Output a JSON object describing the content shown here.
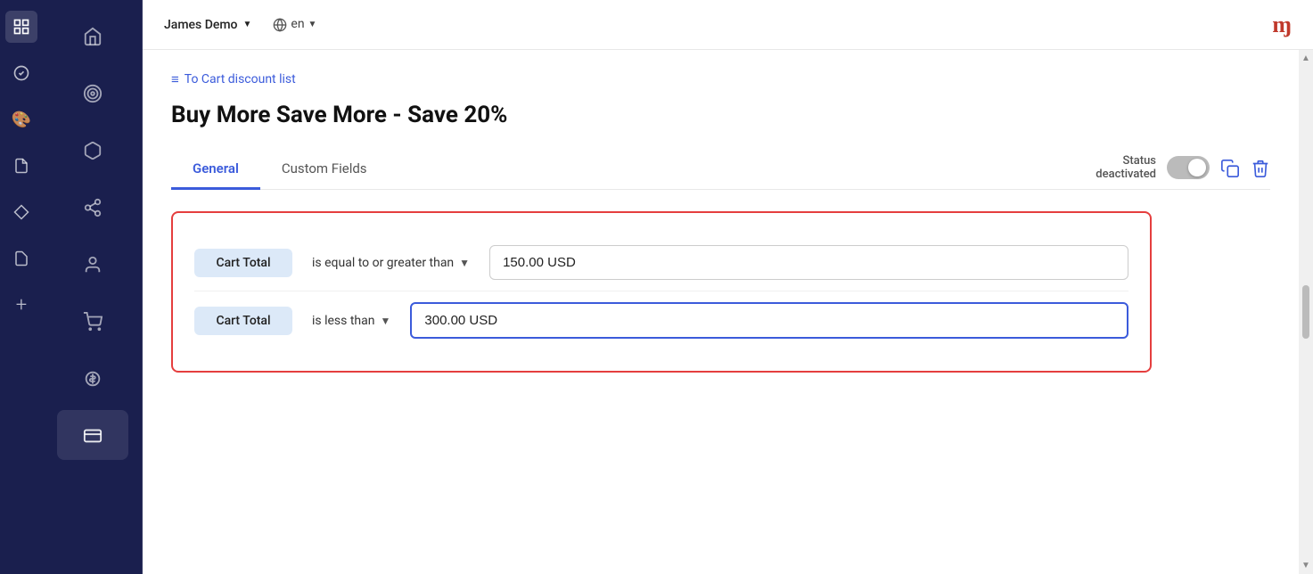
{
  "sidebar_narrow": {
    "icons": [
      {
        "name": "grid-icon",
        "symbol": "⊞",
        "active": false
      },
      {
        "name": "badge-icon",
        "symbol": "◈",
        "active": true
      },
      {
        "name": "palette-icon",
        "symbol": "🎨",
        "active": false
      },
      {
        "name": "document-icon",
        "symbol": "📄",
        "active": false
      },
      {
        "name": "diamond-icon",
        "symbol": "◇",
        "active": false
      },
      {
        "name": "doc2-icon",
        "symbol": "📋",
        "active": false
      },
      {
        "name": "plus-icon",
        "symbol": "+",
        "active": false
      }
    ]
  },
  "sidebar_main": {
    "items": [
      {
        "name": "home-nav",
        "label": "",
        "icon": "🏠",
        "active": false
      },
      {
        "name": "target-nav",
        "label": "",
        "icon": "🎯",
        "active": false
      },
      {
        "name": "cube-nav",
        "label": "",
        "icon": "⬡",
        "active": false
      },
      {
        "name": "flow-nav",
        "label": "",
        "icon": "⚡",
        "active": false
      },
      {
        "name": "person-nav",
        "label": "",
        "icon": "👤",
        "active": false
      },
      {
        "name": "cart-nav",
        "label": "",
        "icon": "🛒",
        "active": false
      },
      {
        "name": "coins-nav",
        "label": "",
        "icon": "🪙",
        "active": false
      },
      {
        "name": "card-nav",
        "label": "",
        "icon": "🃏",
        "active": true
      }
    ]
  },
  "topbar": {
    "user_name": "James Demo",
    "user_chevron": "▼",
    "lang": "en",
    "lang_chevron": "▼",
    "logo": "ɱ"
  },
  "breadcrumb": {
    "icon": "≡",
    "label": "To Cart discount list"
  },
  "page": {
    "title": "Buy More Save More - Save 20%"
  },
  "tabs": [
    {
      "id": "general",
      "label": "General",
      "active": true
    },
    {
      "id": "custom-fields",
      "label": "Custom Fields",
      "active": false
    }
  ],
  "status": {
    "label_line1": "Status",
    "label_line2": "deactivated",
    "toggle_state": "off"
  },
  "action_buttons": {
    "copy_label": "copy",
    "delete_label": "delete"
  },
  "conditions": [
    {
      "id": "row1",
      "field_label": "Cart Total",
      "operator": "is equal to or greater than",
      "value": "150.00 USD",
      "value_focused": false
    },
    {
      "id": "row2",
      "field_label": "Cart Total",
      "operator": "is less than",
      "value": "300.00 USD",
      "value_focused": true
    }
  ]
}
